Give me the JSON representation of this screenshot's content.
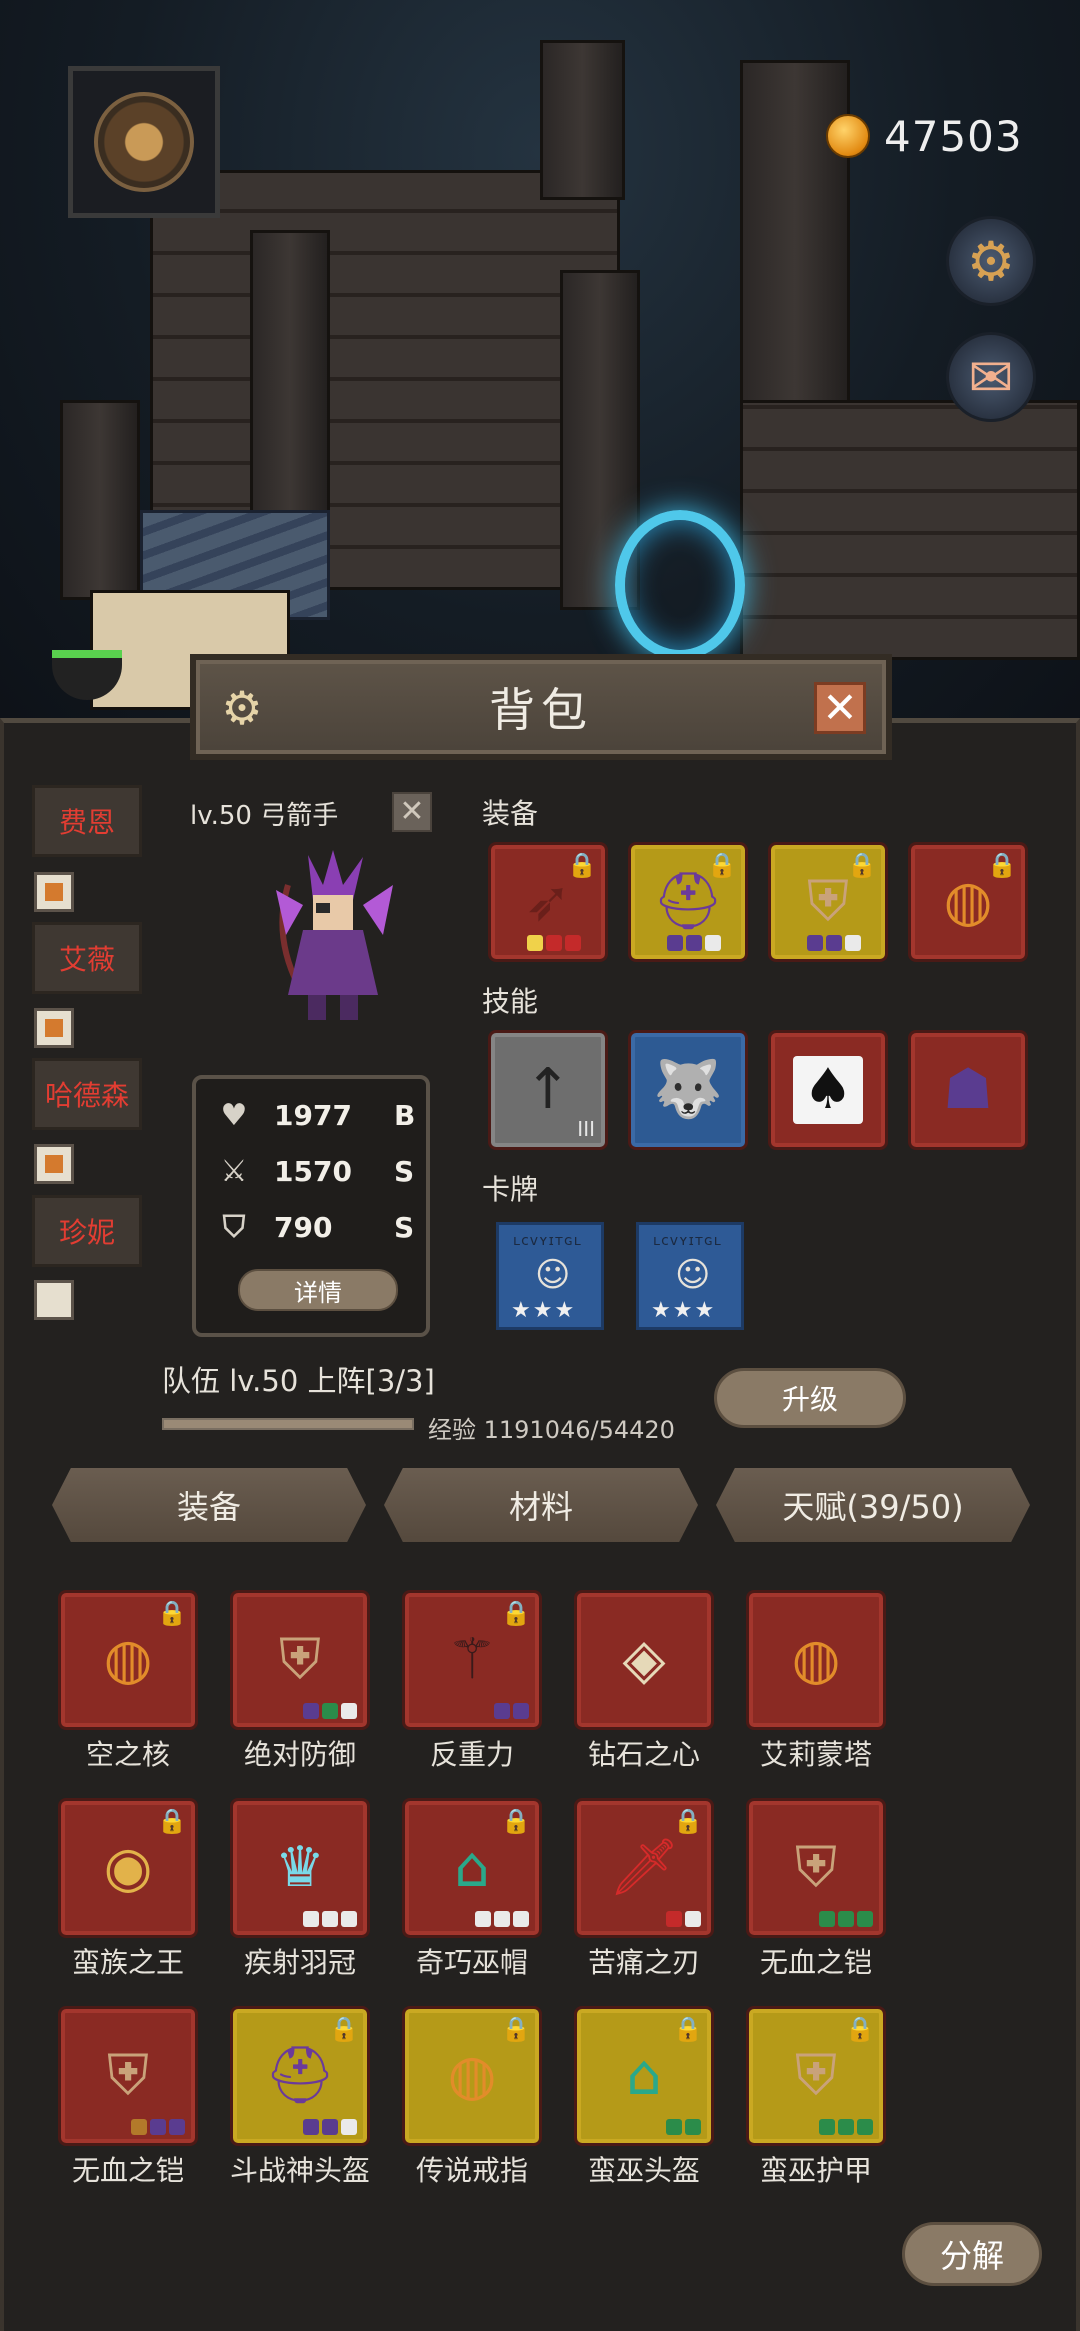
{
  "hud": {
    "coins": "47503",
    "settings_icon": "gear-icon",
    "mail_icon": "envelope-icon"
  },
  "panel": {
    "title": "背包"
  },
  "heroes": [
    {
      "name": "费恩",
      "selected": true
    },
    {
      "name": "艾薇",
      "selected": true
    },
    {
      "name": "哈德森",
      "selected": true
    },
    {
      "name": "珍妮",
      "selected": false
    }
  ],
  "hero": {
    "level_class": "lv.50 弓箭手",
    "stats": [
      {
        "icon": "heart-icon",
        "value": "1977",
        "grade": "B"
      },
      {
        "icon": "sword-icon",
        "value": "1570",
        "grade": "S"
      },
      {
        "icon": "shield-icon",
        "value": "790",
        "grade": "S"
      }
    ],
    "detail_label": "详情"
  },
  "sections": {
    "equipment": "装备",
    "skills": "技能",
    "cards": "卡牌"
  },
  "equipment_slots": [
    {
      "icon": "bow-icon",
      "rarity": "red",
      "locked": true,
      "dots": [
        "y",
        "r",
        "r"
      ]
    },
    {
      "icon": "helmet-icon",
      "rarity": "gold",
      "locked": true,
      "dots": [
        "p",
        "p",
        "w"
      ]
    },
    {
      "icon": "armor-icon",
      "rarity": "gold",
      "locked": true,
      "dots": [
        "p",
        "p",
        "w"
      ]
    },
    {
      "icon": "ring-icon",
      "rarity": "red",
      "locked": true,
      "dots": []
    }
  ],
  "skill_slots": [
    {
      "icon": "arrow-icon",
      "rarity": "grey",
      "tier": "III"
    },
    {
      "icon": "wolf-icon",
      "rarity": "blue",
      "tier": ""
    },
    {
      "icon": "spade-card-icon",
      "rarity": "red",
      "tier": ""
    },
    {
      "icon": "shadow-figure-icon",
      "rarity": "red",
      "tier": ""
    }
  ],
  "cards": [
    {
      "stars": "★★★"
    },
    {
      "stars": "★★★"
    }
  ],
  "team": {
    "info": "队伍 lv.50  上阵[3/3]",
    "exp_text": "经验 1191046/54420",
    "exp_fraction": 1.0,
    "upgrade_label": "升级"
  },
  "tabs": [
    "装备",
    "材料",
    "天赋(39/50)"
  ],
  "inventory": [
    {
      "name": "空之核",
      "rarity": "red",
      "locked": true,
      "icon": "ring-icon",
      "dots": []
    },
    {
      "name": "绝对防御",
      "rarity": "red",
      "locked": false,
      "icon": "armor-icon",
      "dots": [
        "p",
        "g",
        "w"
      ]
    },
    {
      "name": "反重力",
      "rarity": "red",
      "locked": true,
      "icon": "staff-icon",
      "dots": [
        "p",
        "p"
      ]
    },
    {
      "name": "钻石之心",
      "rarity": "red",
      "locked": false,
      "icon": "gem-ring-icon",
      "dots": []
    },
    {
      "name": "艾莉蒙塔",
      "rarity": "red",
      "locked": false,
      "icon": "ring-icon",
      "dots": []
    },
    {
      "name": "蛮族之王",
      "rarity": "red",
      "locked": true,
      "icon": "gold-ring-icon",
      "dots": []
    },
    {
      "name": "疾射羽冠",
      "rarity": "red",
      "locked": false,
      "icon": "crown-icon",
      "dots": [
        "w",
        "w",
        "w"
      ]
    },
    {
      "name": "奇巧巫帽",
      "rarity": "red",
      "locked": true,
      "icon": "hat-icon",
      "dots": [
        "w",
        "w",
        "w"
      ]
    },
    {
      "name": "苦痛之刃",
      "rarity": "red",
      "locked": true,
      "icon": "sword-icon",
      "dots": [
        "r",
        "w"
      ]
    },
    {
      "name": "无血之铠",
      "rarity": "red",
      "locked": false,
      "icon": "armor-icon",
      "dots": [
        "g",
        "g",
        "g"
      ]
    },
    {
      "name": "无血之铠",
      "rarity": "red",
      "locked": false,
      "icon": "armor-icon",
      "dots": [
        "o",
        "p",
        "p"
      ]
    },
    {
      "name": "斗战神头盔",
      "rarity": "gold",
      "locked": true,
      "icon": "helmet-icon",
      "dots": [
        "p",
        "p",
        "w"
      ]
    },
    {
      "name": "传说戒指",
      "rarity": "gold",
      "locked": true,
      "icon": "ring-icon",
      "dots": []
    },
    {
      "name": "蛮巫头盔",
      "rarity": "gold",
      "locked": true,
      "icon": "hat-icon",
      "dots": [
        "g",
        "g"
      ]
    },
    {
      "name": "蛮巫护甲",
      "rarity": "gold",
      "locked": true,
      "icon": "armor-icon",
      "dots": [
        "g",
        "g",
        "g"
      ]
    }
  ],
  "decompose_label": "分解"
}
